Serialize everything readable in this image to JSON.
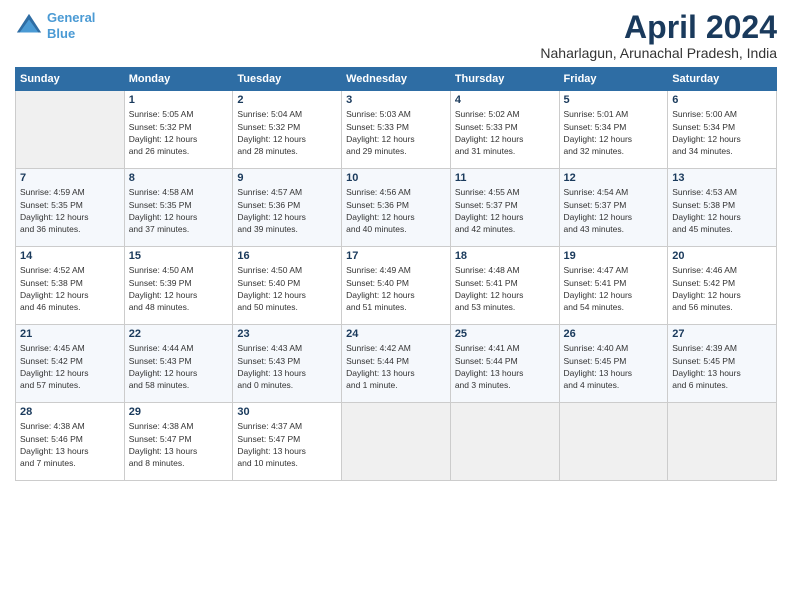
{
  "header": {
    "logo_line1": "General",
    "logo_line2": "Blue",
    "month": "April 2024",
    "location": "Naharlagun, Arunachal Pradesh, India"
  },
  "weekdays": [
    "Sunday",
    "Monday",
    "Tuesday",
    "Wednesday",
    "Thursday",
    "Friday",
    "Saturday"
  ],
  "weeks": [
    [
      {
        "day": "",
        "info": ""
      },
      {
        "day": "1",
        "info": "Sunrise: 5:05 AM\nSunset: 5:32 PM\nDaylight: 12 hours\nand 26 minutes."
      },
      {
        "day": "2",
        "info": "Sunrise: 5:04 AM\nSunset: 5:32 PM\nDaylight: 12 hours\nand 28 minutes."
      },
      {
        "day": "3",
        "info": "Sunrise: 5:03 AM\nSunset: 5:33 PM\nDaylight: 12 hours\nand 29 minutes."
      },
      {
        "day": "4",
        "info": "Sunrise: 5:02 AM\nSunset: 5:33 PM\nDaylight: 12 hours\nand 31 minutes."
      },
      {
        "day": "5",
        "info": "Sunrise: 5:01 AM\nSunset: 5:34 PM\nDaylight: 12 hours\nand 32 minutes."
      },
      {
        "day": "6",
        "info": "Sunrise: 5:00 AM\nSunset: 5:34 PM\nDaylight: 12 hours\nand 34 minutes."
      }
    ],
    [
      {
        "day": "7",
        "info": "Sunrise: 4:59 AM\nSunset: 5:35 PM\nDaylight: 12 hours\nand 36 minutes."
      },
      {
        "day": "8",
        "info": "Sunrise: 4:58 AM\nSunset: 5:35 PM\nDaylight: 12 hours\nand 37 minutes."
      },
      {
        "day": "9",
        "info": "Sunrise: 4:57 AM\nSunset: 5:36 PM\nDaylight: 12 hours\nand 39 minutes."
      },
      {
        "day": "10",
        "info": "Sunrise: 4:56 AM\nSunset: 5:36 PM\nDaylight: 12 hours\nand 40 minutes."
      },
      {
        "day": "11",
        "info": "Sunrise: 4:55 AM\nSunset: 5:37 PM\nDaylight: 12 hours\nand 42 minutes."
      },
      {
        "day": "12",
        "info": "Sunrise: 4:54 AM\nSunset: 5:37 PM\nDaylight: 12 hours\nand 43 minutes."
      },
      {
        "day": "13",
        "info": "Sunrise: 4:53 AM\nSunset: 5:38 PM\nDaylight: 12 hours\nand 45 minutes."
      }
    ],
    [
      {
        "day": "14",
        "info": "Sunrise: 4:52 AM\nSunset: 5:38 PM\nDaylight: 12 hours\nand 46 minutes."
      },
      {
        "day": "15",
        "info": "Sunrise: 4:50 AM\nSunset: 5:39 PM\nDaylight: 12 hours\nand 48 minutes."
      },
      {
        "day": "16",
        "info": "Sunrise: 4:50 AM\nSunset: 5:40 PM\nDaylight: 12 hours\nand 50 minutes."
      },
      {
        "day": "17",
        "info": "Sunrise: 4:49 AM\nSunset: 5:40 PM\nDaylight: 12 hours\nand 51 minutes."
      },
      {
        "day": "18",
        "info": "Sunrise: 4:48 AM\nSunset: 5:41 PM\nDaylight: 12 hours\nand 53 minutes."
      },
      {
        "day": "19",
        "info": "Sunrise: 4:47 AM\nSunset: 5:41 PM\nDaylight: 12 hours\nand 54 minutes."
      },
      {
        "day": "20",
        "info": "Sunrise: 4:46 AM\nSunset: 5:42 PM\nDaylight: 12 hours\nand 56 minutes."
      }
    ],
    [
      {
        "day": "21",
        "info": "Sunrise: 4:45 AM\nSunset: 5:42 PM\nDaylight: 12 hours\nand 57 minutes."
      },
      {
        "day": "22",
        "info": "Sunrise: 4:44 AM\nSunset: 5:43 PM\nDaylight: 12 hours\nand 58 minutes."
      },
      {
        "day": "23",
        "info": "Sunrise: 4:43 AM\nSunset: 5:43 PM\nDaylight: 13 hours\nand 0 minutes."
      },
      {
        "day": "24",
        "info": "Sunrise: 4:42 AM\nSunset: 5:44 PM\nDaylight: 13 hours\nand 1 minute."
      },
      {
        "day": "25",
        "info": "Sunrise: 4:41 AM\nSunset: 5:44 PM\nDaylight: 13 hours\nand 3 minutes."
      },
      {
        "day": "26",
        "info": "Sunrise: 4:40 AM\nSunset: 5:45 PM\nDaylight: 13 hours\nand 4 minutes."
      },
      {
        "day": "27",
        "info": "Sunrise: 4:39 AM\nSunset: 5:45 PM\nDaylight: 13 hours\nand 6 minutes."
      }
    ],
    [
      {
        "day": "28",
        "info": "Sunrise: 4:38 AM\nSunset: 5:46 PM\nDaylight: 13 hours\nand 7 minutes."
      },
      {
        "day": "29",
        "info": "Sunrise: 4:38 AM\nSunset: 5:47 PM\nDaylight: 13 hours\nand 8 minutes."
      },
      {
        "day": "30",
        "info": "Sunrise: 4:37 AM\nSunset: 5:47 PM\nDaylight: 13 hours\nand 10 minutes."
      },
      {
        "day": "",
        "info": ""
      },
      {
        "day": "",
        "info": ""
      },
      {
        "day": "",
        "info": ""
      },
      {
        "day": "",
        "info": ""
      }
    ]
  ]
}
